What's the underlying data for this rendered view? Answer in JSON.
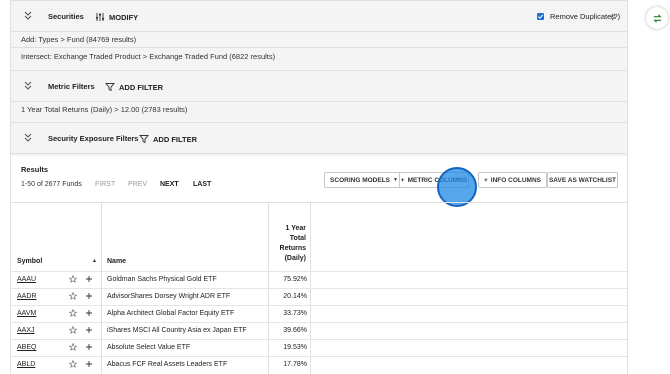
{
  "securities": {
    "title": "Securities",
    "modify_label": "MODIFY",
    "remove_duplicates_label": "Remove Duplicates",
    "remove_duplicates_checked": true,
    "help_label": "(?)",
    "add_line": "Add: Types > Fund (84769 results)",
    "intersect_line": "Intersect: Exchange Traded Product > Exchange Traded Fund (6822 results)"
  },
  "metric_filters": {
    "title": "Metric Filters",
    "add_filter_label": "ADD FILTER",
    "filter_line": "1 Year Total Returns (Daily) > 12.00 (2783 results)"
  },
  "exposure_filters": {
    "title": "Security Exposure Filters",
    "add_filter_label": "ADD FILTER"
  },
  "results": {
    "title": "Results",
    "range_text": "1-50 of 2677 Funds",
    "first_label": "FIRST",
    "prev_label": "PREV",
    "next_label": "NEXT",
    "last_label": "LAST",
    "scoring_models_label": "SCORING MODELS",
    "metric_columns_label": "METRIC COLUMNS",
    "info_columns_label": "INFO COLUMNS",
    "save_watchlist_label": "SAVE AS WATCHLIST"
  },
  "table": {
    "headers": {
      "symbol": "Symbol",
      "name": "Name",
      "returns": [
        "1 Year",
        "Total",
        "Returns",
        "(Daily)"
      ]
    },
    "rows": [
      {
        "symbol": "AAAU",
        "name": "Goldman Sachs Physical Gold ETF",
        "ret": "75.92%"
      },
      {
        "symbol": "AADR",
        "name": "AdvisorShares Dorsey Wright ADR ETF",
        "ret": "20.14%"
      },
      {
        "symbol": "AAVM",
        "name": "Alpha Architect Global Factor Equity ETF",
        "ret": "33.73%"
      },
      {
        "symbol": "AAXJ",
        "name": "iShares MSCI All Country Asia ex Japan ETF",
        "ret": "39.66%"
      },
      {
        "symbol": "ABEQ",
        "name": "Absolute Select Value ETF",
        "ret": "19.53%"
      },
      {
        "symbol": "ABLD",
        "name": "Abacus FCF Real Assets Leaders ETF",
        "ret": "17.78%"
      }
    ]
  },
  "colors": {
    "accent": "#1f6fd1",
    "click_indicator": "#1e88e5",
    "side_button_icon": "#2e7d32"
  },
  "icons": {
    "collapse": "double-chevron-icon",
    "modify": "sliders-icon",
    "filter": "filter-funnel-icon",
    "favorite": "star-icon",
    "add": "plus-icon",
    "sort": "sort-up-icon",
    "side": "swap-icon"
  }
}
